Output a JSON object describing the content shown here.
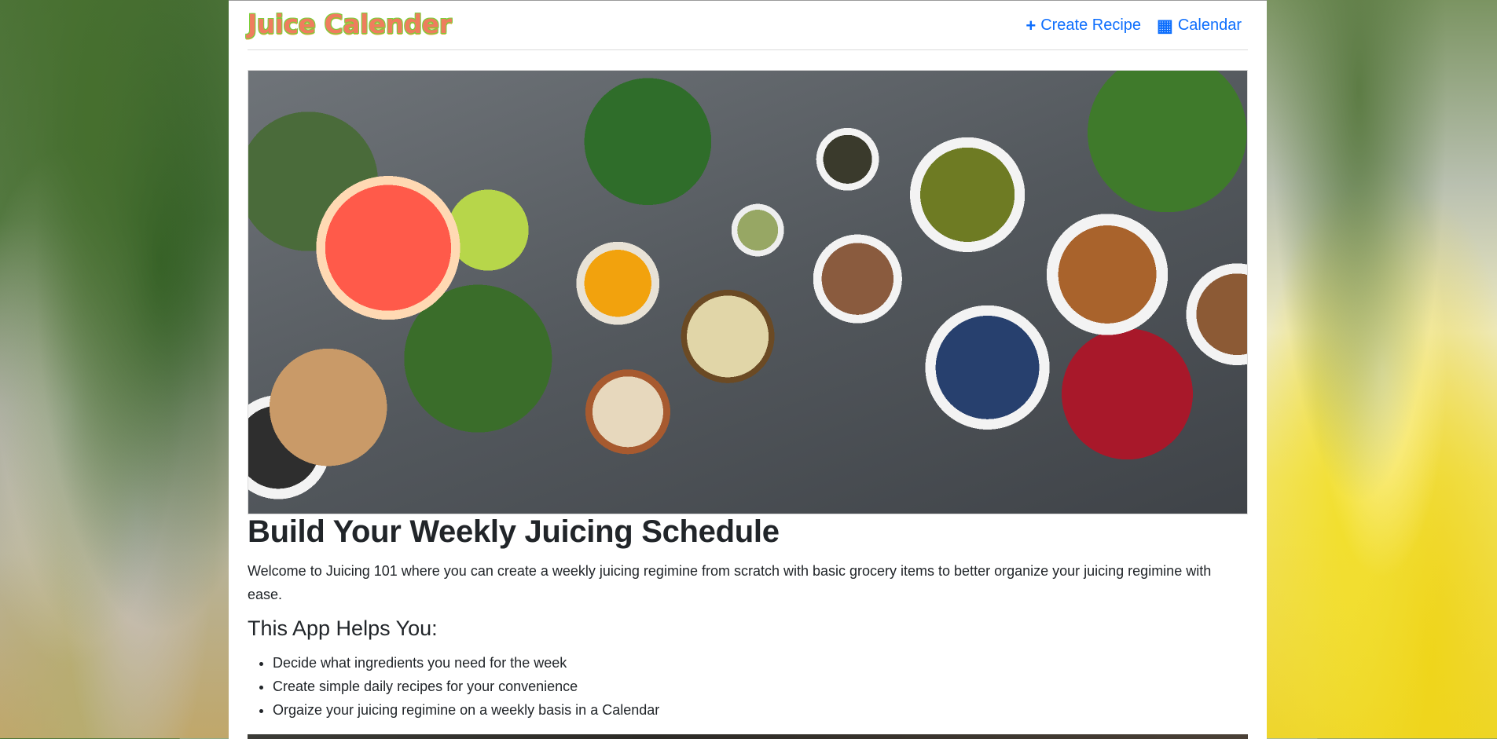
{
  "navbar": {
    "brand": "Juice Calender",
    "links": [
      {
        "icon": "plus-icon",
        "glyph": "+",
        "label": "Create Recipe"
      },
      {
        "icon": "calendar-icon",
        "glyph": "▦",
        "label": "Calendar"
      }
    ]
  },
  "hero_image": {
    "subject": "fruits-vegetables-spread"
  },
  "main": {
    "heading": "Build Your Weekly Juicing Schedule",
    "intro": "Welcome to Juicing 101 where you can create a weekly juicing regimine from scratch with basic grocery items to better organize your juicing regimine with ease.",
    "subheading": "This App Helps You:",
    "features": [
      "Decide what ingredients you need for the week",
      "Create simple daily recipes for your convenience",
      "Orgaize your juicing regimine on a weekly basis in a Calendar"
    ]
  },
  "colors": {
    "link": "#0d6efd",
    "brand_fill": "#ef7d5e",
    "brand_outline": "#7bcf3a",
    "text": "#212529"
  }
}
